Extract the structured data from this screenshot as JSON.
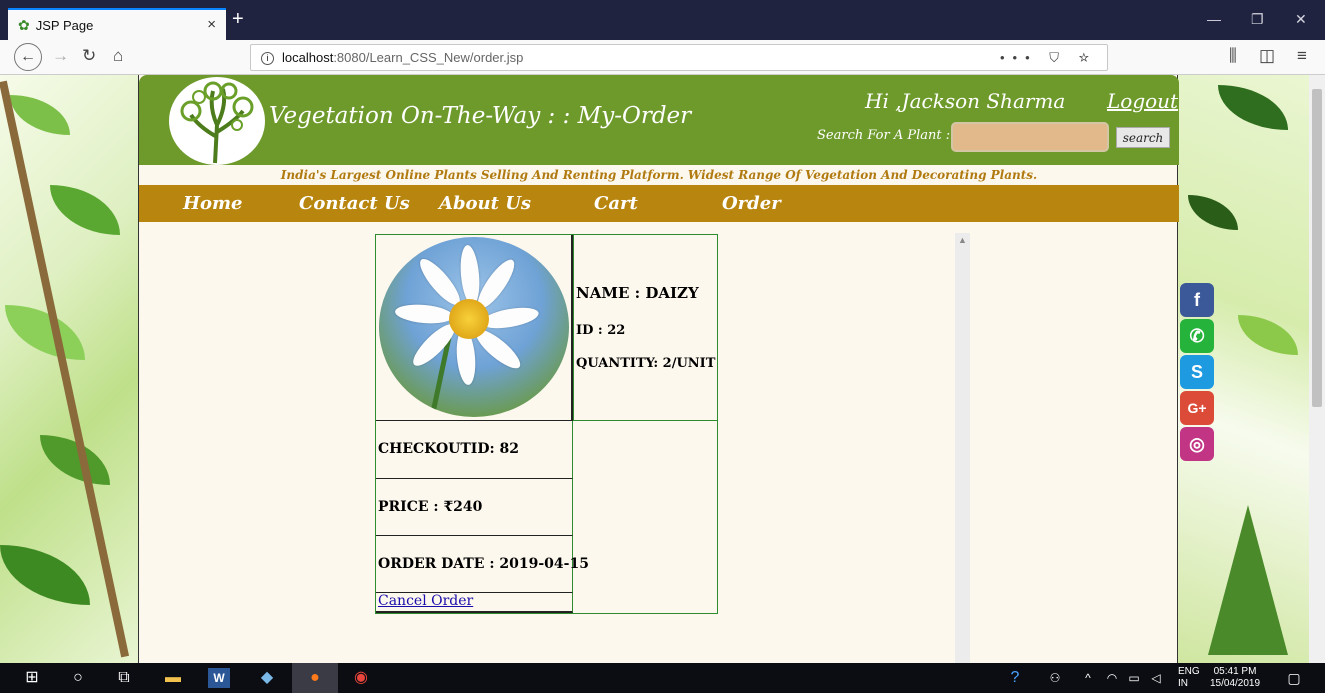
{
  "browser": {
    "tab_title": "JSP Page",
    "tab_close": "×",
    "new_tab": "+",
    "url_host": "localhost",
    "url_path": ":8080/Learn_CSS_New/order.jsp",
    "url_actions": "••• ⛉ ☆",
    "window_controls": [
      "—",
      "❐",
      "✕"
    ]
  },
  "site": {
    "title": "Vegetation On-The-Way : : My-Order",
    "greeting": "Hi ,Jackson Sharma",
    "logout": "Logout",
    "search_label": "Search For A Plant :",
    "search_button": "search",
    "tagline": "India's Largest Online Plants Selling And Renting Platform. Widest Range Of Vegetation And Decorating Plants.",
    "menu": [
      "Home",
      "Contact Us",
      "About Us",
      "Cart",
      "Order"
    ]
  },
  "order": {
    "name": "NAME : DAIZY",
    "id": "ID : 22",
    "quantity": "QUANTITY: 2/UNIT",
    "checkout_id": "CHECKOUTID: 82",
    "price": "PRICE : ₹240",
    "order_date": "ORDER DATE : 2019-04-15",
    "cancel": "Cancel Order"
  },
  "social": [
    {
      "name": "facebook",
      "glyph": "f",
      "color": "#3b5998"
    },
    {
      "name": "whatsapp",
      "glyph": "✆",
      "color": "#25b33c"
    },
    {
      "name": "skype",
      "glyph": "S",
      "color": "#1e9be0"
    },
    {
      "name": "google-plus",
      "glyph": "G+",
      "color": "#dc4a38"
    },
    {
      "name": "instagram",
      "glyph": "◎",
      "color": "#c13584"
    }
  ],
  "taskbar": {
    "language_line1": "ENG",
    "language_line2": "IN",
    "time": "05:41 PM",
    "date": "15/04/2019"
  }
}
